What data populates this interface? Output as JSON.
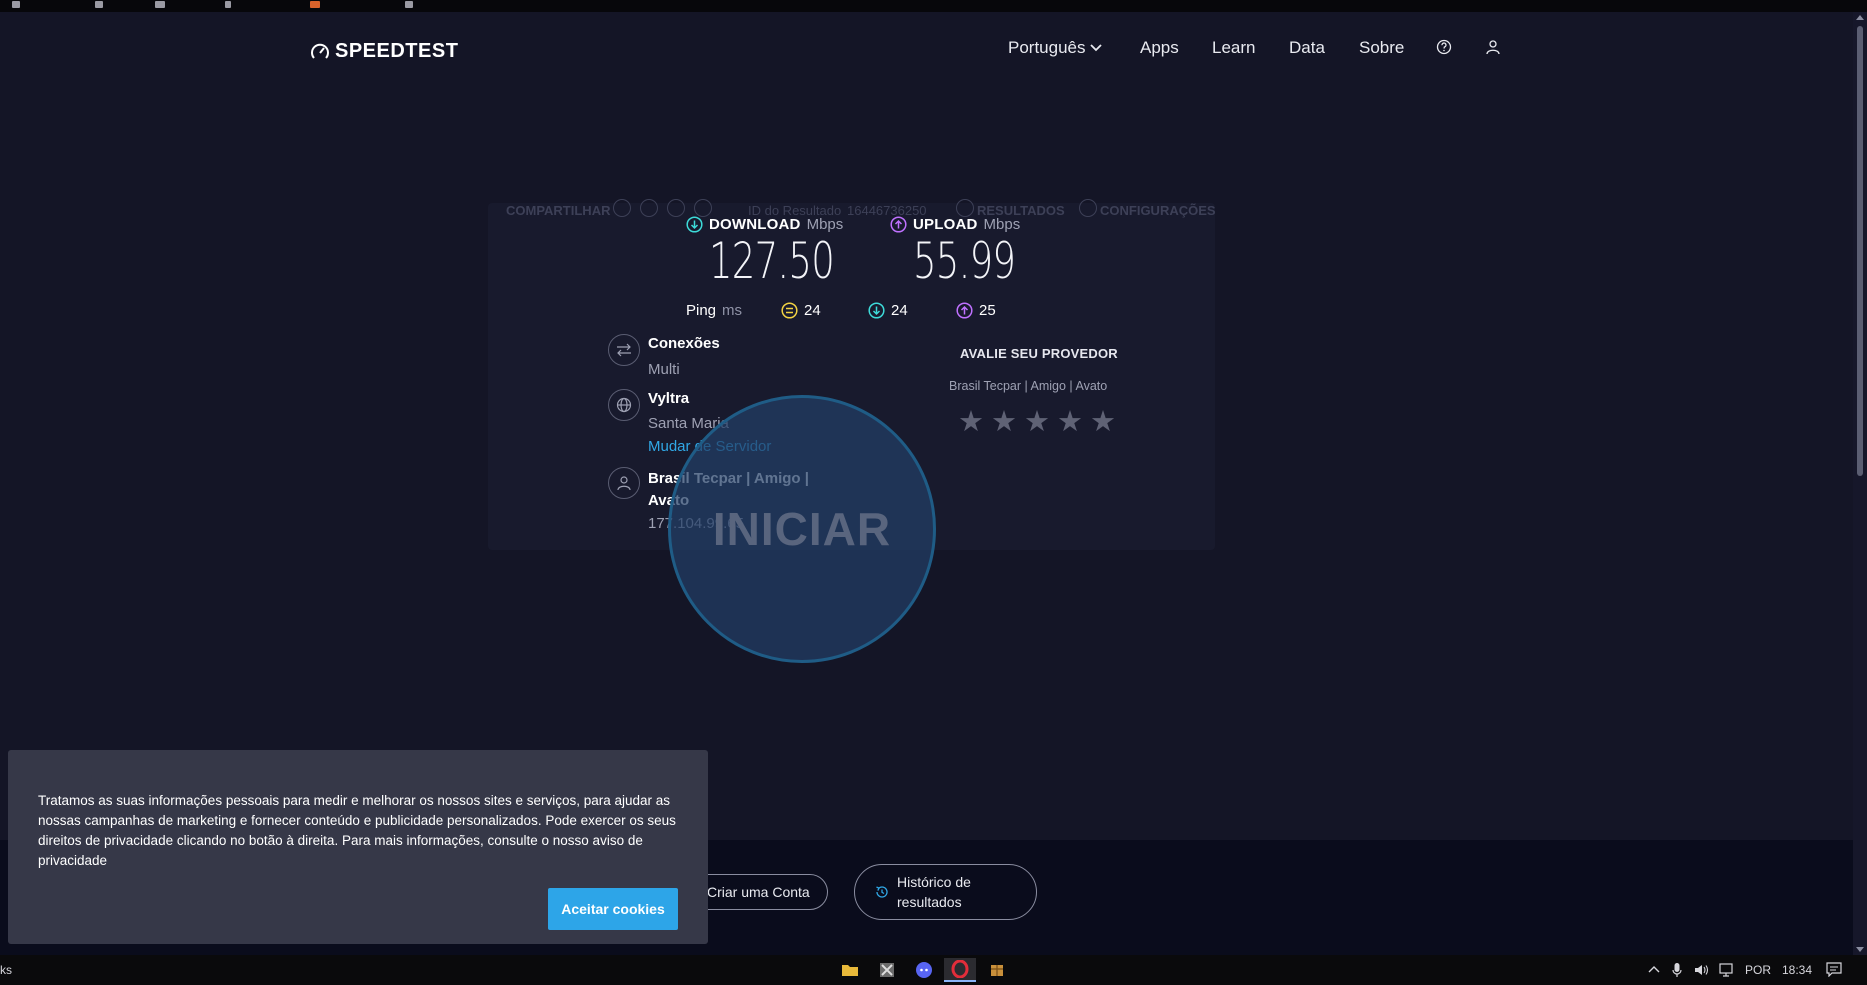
{
  "app": {
    "logo_text": "SPEEDTEST"
  },
  "nav": {
    "language": "Português",
    "apps": "Apps",
    "learn": "Learn",
    "data": "Data",
    "about": "Sobre"
  },
  "result_bar": {
    "share": "COMPARTILHAR",
    "result_id_label": "ID do Resultado",
    "result_id": "16446736250",
    "results": "RESULTADOS",
    "settings": "CONFIGURAÇÕES"
  },
  "metrics": {
    "download_label": "DOWNLOAD",
    "download_unit": "Mbps",
    "download_value": "127.50",
    "upload_label": "UPLOAD",
    "upload_unit": "Mbps",
    "upload_value": "55.99"
  },
  "ping": {
    "label": "Ping",
    "unit": "ms",
    "idle": "24",
    "down": "24",
    "up": "25"
  },
  "info": {
    "connections_title": "Conexões",
    "connections_value": "Multi",
    "server_title": "Vyltra",
    "server_city": "Santa Maria",
    "change_server": "Mudar de Servidor",
    "isp_title": "Brasil Tecpar | Amigo | Avato",
    "isp_ip": "177.104.99.65"
  },
  "rating": {
    "title": "AVALIE SEU PROVEDOR",
    "provider": "Brasil Tecpar | Amigo | Avato",
    "stars": 5
  },
  "start_button": "INICIAR",
  "footer": {
    "create_account": "Criar uma Conta",
    "history_line1": "Histórico de",
    "history_line2": "resultados"
  },
  "cookie": {
    "text": "Tratamos as suas informações pessoais para medir e melhorar os nossos sites e serviços, para ajudar as nossas campanhas de marketing e fornecer conteúdo e publicidade personalizados. Pode exercer os seus direitos de privacidade clicando no botão à direita. Para mais informações, consulte o nosso aviso de privacidade",
    "accept": "Aceitar cookies"
  },
  "taskbar": {
    "left_text": "ks",
    "lang": "POR",
    "time": "18:34"
  },
  "colors": {
    "background": "#141526",
    "download_accent": "#3ddbd9",
    "upload_accent": "#bf71ff",
    "ping_accent": "#f2d343",
    "link": "#30a8e6",
    "accept_button": "#2da5e8"
  }
}
